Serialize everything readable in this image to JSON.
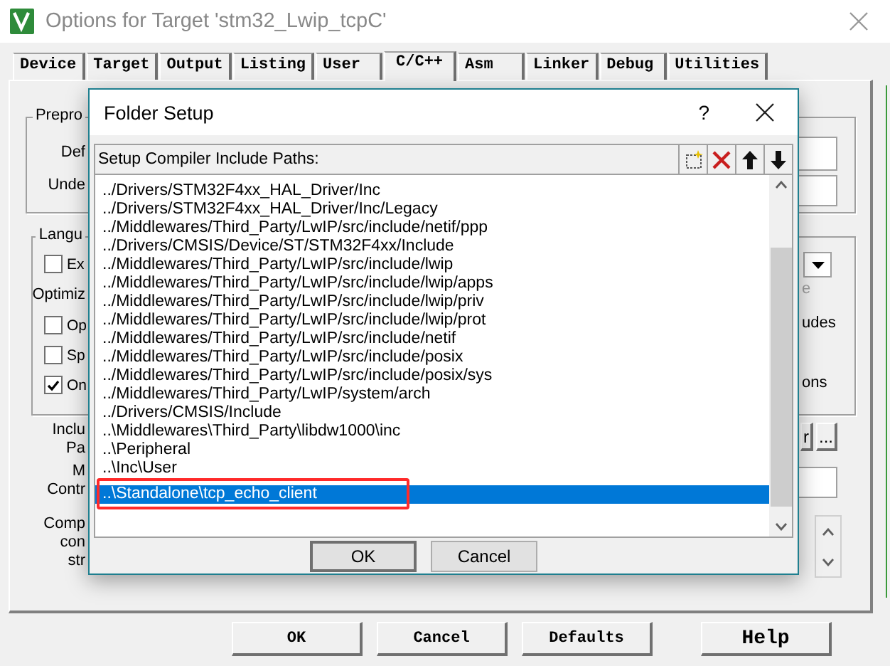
{
  "window": {
    "title": "Options for Target 'stm32_Lwip_tcpC'"
  },
  "tabs": [
    {
      "label": "Device",
      "selected": false
    },
    {
      "label": "Target",
      "selected": false
    },
    {
      "label": "Output",
      "selected": false
    },
    {
      "label": "Listing",
      "selected": false
    },
    {
      "label": "User",
      "selected": false
    },
    {
      "label": "C/C++",
      "selected": true
    },
    {
      "label": "Asm",
      "selected": false
    },
    {
      "label": "Linker",
      "selected": false
    },
    {
      "label": "Debug",
      "selected": false
    },
    {
      "label": "Utilities",
      "selected": false
    }
  ],
  "left_fragments": [
    {
      "kind": "group_title",
      "text": "Prepro"
    },
    {
      "kind": "label",
      "text": "Def"
    },
    {
      "kind": "label",
      "text": "Unde"
    },
    {
      "kind": "group_title",
      "text": "Langu"
    },
    {
      "kind": "checkbox",
      "text": "Ex",
      "checked": false
    },
    {
      "kind": "label",
      "text": "Optimiz"
    },
    {
      "kind": "checkbox",
      "text": "Op",
      "checked": false
    },
    {
      "kind": "checkbox",
      "text": "Sp",
      "checked": false
    },
    {
      "kind": "checkbox",
      "text": "On",
      "checked": true
    },
    {
      "kind": "label",
      "text": "Inclu"
    },
    {
      "kind": "label",
      "text": "Pa"
    },
    {
      "kind": "label",
      "text": "M"
    },
    {
      "kind": "label",
      "text": "Contr"
    },
    {
      "kind": "label",
      "text": "Comp"
    },
    {
      "kind": "label",
      "text": "con"
    },
    {
      "kind": "label",
      "text": "str"
    }
  ],
  "right_fragments": [
    {
      "kind": "greyed",
      "text": "e"
    },
    {
      "kind": "label",
      "text": "udes"
    },
    {
      "kind": "label",
      "text": "ons"
    },
    {
      "kind": "button",
      "text": "r"
    },
    {
      "kind": "button",
      "text": "..."
    }
  ],
  "buttons": [
    "OK",
    "Cancel",
    "Defaults",
    "Help"
  ],
  "folder_setup": {
    "title": "Folder Setup",
    "help": "?",
    "list_label": "Setup Compiler Include Paths:",
    "paths": [
      {
        "text": "../Drivers/STM32F4xx_HAL_Driver/Inc",
        "selected": false,
        "highlighted": false
      },
      {
        "text": "../Drivers/STM32F4xx_HAL_Driver/Inc/Legacy",
        "selected": false,
        "highlighted": false
      },
      {
        "text": "../Middlewares/Third_Party/LwIP/src/include/netif/ppp",
        "selected": false,
        "highlighted": false
      },
      {
        "text": "../Drivers/CMSIS/Device/ST/STM32F4xx/Include",
        "selected": false,
        "highlighted": false
      },
      {
        "text": "../Middlewares/Third_Party/LwIP/src/include/lwip",
        "selected": false,
        "highlighted": false
      },
      {
        "text": "../Middlewares/Third_Party/LwIP/src/include/lwip/apps",
        "selected": false,
        "highlighted": false
      },
      {
        "text": "../Middlewares/Third_Party/LwIP/src/include/lwip/priv",
        "selected": false,
        "highlighted": false
      },
      {
        "text": "../Middlewares/Third_Party/LwIP/src/include/lwip/prot",
        "selected": false,
        "highlighted": false
      },
      {
        "text": "../Middlewares/Third_Party/LwIP/src/include/netif",
        "selected": false,
        "highlighted": false
      },
      {
        "text": "../Middlewares/Third_Party/LwIP/src/include/posix",
        "selected": false,
        "highlighted": false
      },
      {
        "text": "../Middlewares/Third_Party/LwIP/src/include/posix/sys",
        "selected": false,
        "highlighted": false
      },
      {
        "text": "../Middlewares/Third_Party/LwIP/system/arch",
        "selected": false,
        "highlighted": false
      },
      {
        "text": "../Drivers/CMSIS/Include",
        "selected": false,
        "highlighted": false
      },
      {
        "text": "..\\Middlewares\\Third_Party\\libdw1000\\inc",
        "selected": false,
        "highlighted": false
      },
      {
        "text": "..\\Peripheral",
        "selected": false,
        "highlighted": false
      },
      {
        "text": "..\\Inc\\User",
        "selected": false,
        "highlighted": false
      },
      {
        "text": "..\\Standalone\\tcp_echo_client",
        "selected": true,
        "highlighted": true
      }
    ],
    "buttons": [
      "OK",
      "Cancel"
    ]
  }
}
